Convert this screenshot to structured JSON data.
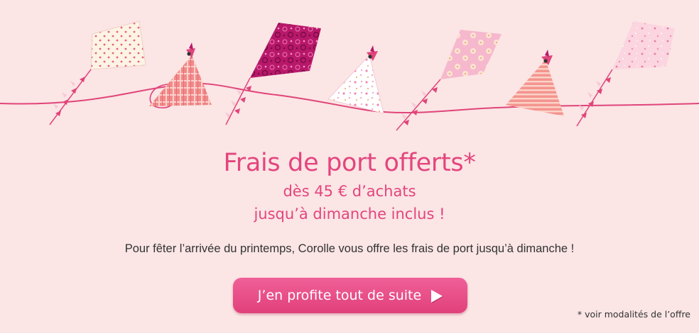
{
  "banner": {
    "title": "Frais de port offerts*",
    "subtitle_line1": "dès 45 € d’achats",
    "subtitle_line2": "jusqu’à dimanche inclus !",
    "body": "Pour fêter l’arrivée du printemps, Corolle vous offre les frais de port jusqu’à dimanche !",
    "cta_label": "J’en profite tout de suite",
    "cta_icon": "arrow-right-icon",
    "footnote": "* voir modalités de l’offre"
  },
  "illustration": {
    "subject": "garland of paper kites and origami birds",
    "kites": [
      "kite-cream-hearts",
      "kite-magenta-floral",
      "kite-pink-flowers",
      "kite-pink-stars"
    ],
    "birds": [
      "bird-plaid",
      "bird-white-floral",
      "bird-stripes"
    ],
    "colors": {
      "accent": "#e3457e",
      "background": "#fbe5e5",
      "string": "#e0457a",
      "button": "#e94a84"
    }
  }
}
